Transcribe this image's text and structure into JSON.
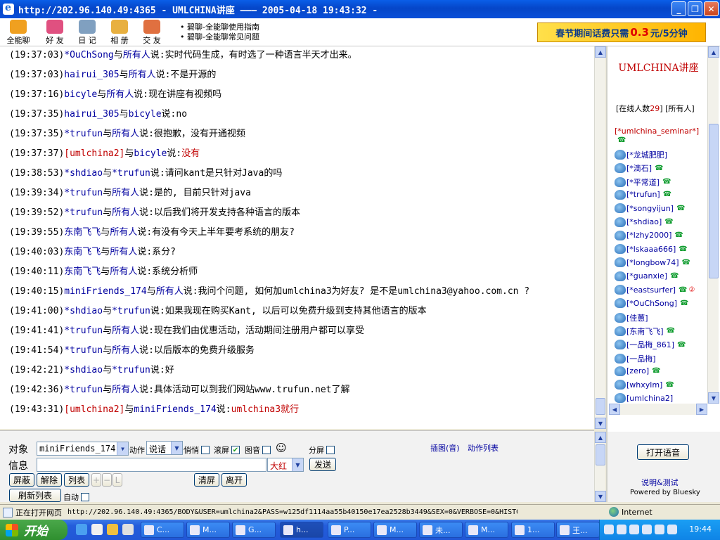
{
  "window": {
    "title": "http://202.96.140.49:4365 - UMLCHINA讲座 ——— 2005-04-18 19:43:32 -",
    "min": "_",
    "max": "❐",
    "close": "✕"
  },
  "toolbar": {
    "items": [
      {
        "label": "全能聊",
        "color": "#f0a020"
      },
      {
        "label": "好 友",
        "color": "#e05080"
      },
      {
        "label": "日 记",
        "color": "#80a0c0"
      },
      {
        "label": "相 册",
        "color": "#e8b040"
      },
      {
        "label": "交 友",
        "color": "#e07040"
      }
    ],
    "links": [
      "• 碧聊-全能聊使用指南",
      "• 碧聊-全能聊常见问题"
    ],
    "banner": {
      "prefix": "春节期间话费只需",
      "price": "0.3",
      "suffix": "元/5分钟"
    }
  },
  "chat": {
    "lines": [
      {
        "time": "(19:37:03)",
        "from": "*OuChSong",
        "mid": "与",
        "to": "所有人",
        "say": "说:",
        "msg": "实时代码生成，有时选了一种语言半天才出来。",
        "red": false
      },
      {
        "time": "(19:37:03)",
        "from": "hairui_305",
        "mid": "与",
        "to": "所有人",
        "say": "说:",
        "msg": "不是开源的",
        "red": false
      },
      {
        "time": "(19:37:16)",
        "from": "bicyle",
        "mid": "与",
        "to": "所有人",
        "say": "说:",
        "msg": "现在讲座有视频吗",
        "red": false
      },
      {
        "time": "(19:37:35)",
        "from": "hairui_305",
        "mid": "与",
        "to": "bicyle",
        "say": "说:",
        "msg": "no",
        "red": false
      },
      {
        "time": "(19:37:35)",
        "from": "*trufun",
        "mid": "与",
        "to": "所有人",
        "say": "说:",
        "msg": "很抱歉，没有开通视频",
        "red": false
      },
      {
        "time": "(19:37:37)",
        "from": "[umlchina2]",
        "mid": "与",
        "to": "bicyle",
        "say": "说:",
        "msg": "没有",
        "red": true
      },
      {
        "time": "(19:38:53)",
        "from": "*shdiao",
        "mid": "与",
        "to": "*trufun",
        "say": "说:",
        "msg": "请问kant是只针对Java的吗",
        "red": false
      },
      {
        "time": "(19:39:34)",
        "from": "*trufun",
        "mid": "与",
        "to": "所有人",
        "say": "说:",
        "msg": "是的, 目前只针对java",
        "red": false
      },
      {
        "time": "(19:39:52)",
        "from": "*trufun",
        "mid": "与",
        "to": "所有人",
        "say": "说:",
        "msg": "以后我们将开发支持各种语言的版本",
        "red": false
      },
      {
        "time": "(19:39:55)",
        "from": "东南飞飞",
        "mid": "与",
        "to": "所有人",
        "say": "说:",
        "msg": "有没有今天上半年要考系统的朋友?",
        "red": false
      },
      {
        "time": "(19:40:03)",
        "from": "东南飞飞",
        "mid": "与",
        "to": "所有人",
        "say": "说:",
        "msg": "系分?",
        "red": false
      },
      {
        "time": "(19:40:11)",
        "from": "东南飞飞",
        "mid": "与",
        "to": "所有人",
        "say": "说:",
        "msg": "系统分析师",
        "red": false
      },
      {
        "time": "(19:40:15)",
        "from": "miniFriends_174",
        "mid": "与",
        "to": "所有人",
        "say": "说:",
        "msg": "我问个问题, 如何加umlchina3为好友? 是不是umlchina3@yahoo.com.cn ?",
        "red": false
      },
      {
        "time": "(19:41:00)",
        "from": "*shdiao",
        "mid": "与",
        "to": "*trufun",
        "say": "说:",
        "msg": "如果我现在购买Kant, 以后可以免费升级到支持其他语言的版本",
        "red": false
      },
      {
        "time": "(19:41:41)",
        "from": "*trufun",
        "mid": "与",
        "to": "所有人",
        "say": "说:",
        "msg": "现在我们由优惠活动，活动期间注册用户都可以享受",
        "red": false
      },
      {
        "time": "(19:41:54)",
        "from": "*trufun",
        "mid": "与",
        "to": "所有人",
        "say": "说:",
        "msg": "以后版本的免费升级服务",
        "red": false
      },
      {
        "time": "(19:42:21)",
        "from": "*shdiao",
        "mid": "与",
        "to": "*trufun",
        "say": "说:",
        "msg": "好",
        "red": false
      },
      {
        "time": "(19:42:36)",
        "from": "*trufun",
        "mid": "与",
        "to": "所有人",
        "say": "说:",
        "msg": "具体活动可以到我们网站www.trufun.net了解",
        "red": false
      },
      {
        "time": "(19:43:31)",
        "from": "[umlchina2]",
        "mid": "与",
        "to": "miniFriends_174",
        "say": "说:",
        "msg": "umlchina3就行",
        "red": true
      }
    ]
  },
  "right": {
    "room_title": "UMLCHINA讲座",
    "online_prefix": "[在线人数",
    "online_count": "29",
    "online_suffix": "]",
    "all_label": "[所有人]",
    "host": "[*umlchina_seminar*]",
    "users": [
      {
        "name": "[*龙城肥肥]",
        "phone": false,
        "badge": ""
      },
      {
        "name": "[*滴石]",
        "phone": true,
        "badge": ""
      },
      {
        "name": "[*平常道]",
        "phone": true,
        "badge": ""
      },
      {
        "name": "[*trufun]",
        "phone": true,
        "badge": ""
      },
      {
        "name": "[*songyijun]",
        "phone": true,
        "badge": ""
      },
      {
        "name": "[*shdiao]",
        "phone": true,
        "badge": ""
      },
      {
        "name": "[*lzhy2000]",
        "phone": true,
        "badge": ""
      },
      {
        "name": "[*lskaaa666]",
        "phone": true,
        "badge": ""
      },
      {
        "name": "[*longbow74]",
        "phone": true,
        "badge": ""
      },
      {
        "name": "[*guanxie]",
        "phone": true,
        "badge": ""
      },
      {
        "name": "[*eastsurfer]",
        "phone": true,
        "badge": "②"
      },
      {
        "name": "[*OuChSong]",
        "phone": true,
        "badge": ""
      },
      {
        "name": "[佳蕙]",
        "phone": false,
        "badge": ""
      },
      {
        "name": "[东南飞飞]",
        "phone": true,
        "badge": ""
      },
      {
        "name": "[一品梅_861]",
        "phone": true,
        "badge": ""
      },
      {
        "name": "[一品梅]",
        "phone": false,
        "badge": ""
      },
      {
        "name": "[zero]",
        "phone": true,
        "badge": ""
      },
      {
        "name": "[whxylm]",
        "phone": true,
        "badge": ""
      },
      {
        "name": "[umlchina2]",
        "phone": false,
        "badge": ""
      }
    ],
    "voice_button": "打开语音",
    "help_link": "说明&测试",
    "powered": "Powered by Bluesky"
  },
  "controls": {
    "target_label": "对象",
    "target_value": "miniFriends_174",
    "action_label": "动作",
    "action_value": "说话",
    "whisper_label": "悄悄",
    "scroll_label": "滚屏",
    "image_sound_label": "图音",
    "split_label": "分屏",
    "smiley": "☺",
    "insert_link": "插图(音)",
    "action_list_link": "动作列表",
    "message_label": "信息",
    "color_value": "大红",
    "send_button": "发送",
    "mask_button": "屏蔽",
    "unmask_button": "解除",
    "list_button": "列表",
    "plus": "+",
    "minus": "−",
    "L": "L",
    "clear_button": "清屏",
    "leave_button": "离开",
    "refresh_button": "刷新列表",
    "auto_label": "自动"
  },
  "status": {
    "text": "正在打开网页",
    "url": "http://202.96.140.49:4365/BODY&USER=umlchina2&PASS=w125df1114aa55b40150e17ea2528b3449&SEX=0&VERBOSE=0&HISTO",
    "zone": "Internet"
  },
  "taskbar": {
    "start": "开始",
    "tasks": [
      "C...",
      "M...",
      "G...",
      "h...",
      "P...",
      "M...",
      "未...",
      "M...",
      "1...",
      "王..."
    ],
    "clock": "19:44"
  }
}
